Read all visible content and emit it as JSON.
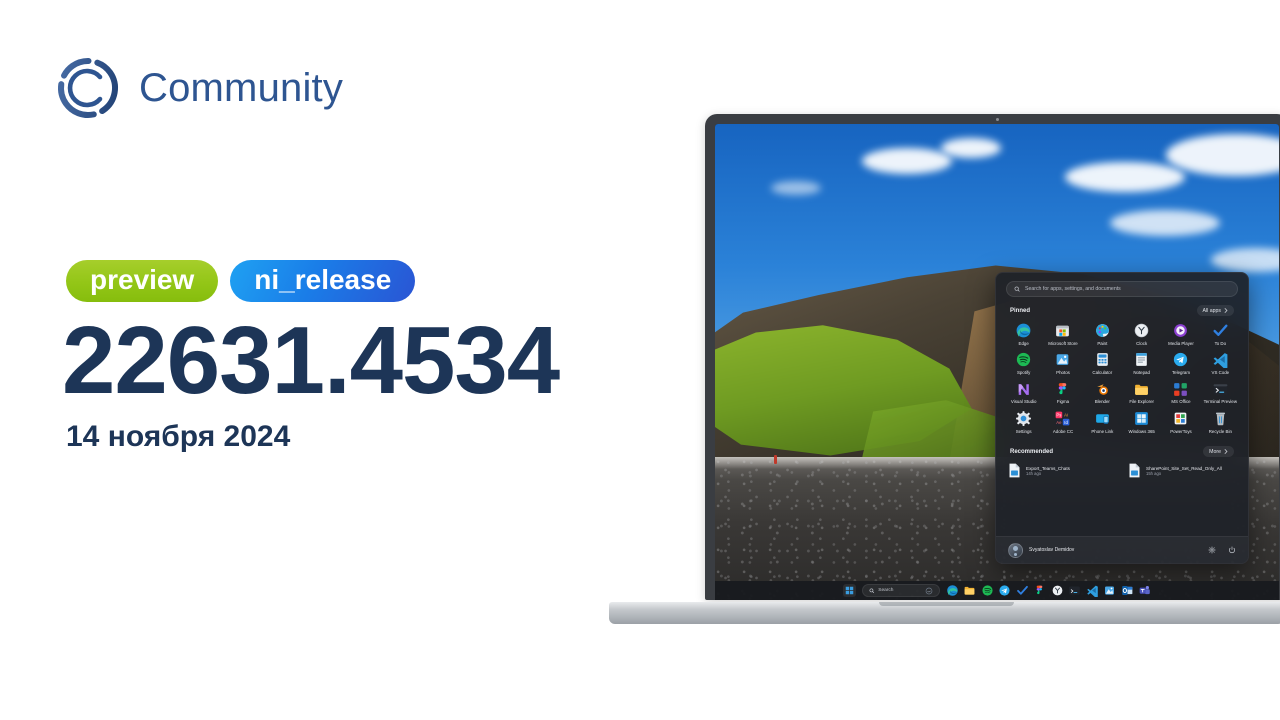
{
  "brand": {
    "name": "Community",
    "logo_icon": "community-ring-c-icon",
    "color": "#2e5591"
  },
  "release": {
    "badges": [
      {
        "label": "preview",
        "color": "#93c617"
      },
      {
        "label": "ni_release",
        "color": "#1a7de8"
      }
    ],
    "build": "22631.4534",
    "date": "14 ноября 2024",
    "text_color": "#1d3557"
  },
  "device": {
    "type": "laptop",
    "camera_icon": "webcam-dot-icon"
  },
  "wallpaper": {
    "description": "Iceland black sand beach with mossy basalt cliff under blue sky"
  },
  "start_menu": {
    "search": {
      "placeholder": "Search for apps, settings, and documents",
      "icon": "search-icon"
    },
    "pinned": {
      "title": "Pinned",
      "all_apps_label": "All apps",
      "all_apps_icon": "chevron-right-icon",
      "apps": [
        {
          "label": "Edge",
          "icon": "edge-icon"
        },
        {
          "label": "Microsoft Store",
          "icon": "microsoft-store-icon"
        },
        {
          "label": "Paint",
          "icon": "paint-icon"
        },
        {
          "label": "Clock",
          "icon": "clock-icon"
        },
        {
          "label": "Media Player",
          "icon": "media-player-icon"
        },
        {
          "label": "To Do",
          "icon": "to-do-icon"
        },
        {
          "label": "Spotify",
          "icon": "spotify-icon"
        },
        {
          "label": "Photos",
          "icon": "photos-icon"
        },
        {
          "label": "Calculator",
          "icon": "calculator-icon"
        },
        {
          "label": "Notepad",
          "icon": "notepad-icon"
        },
        {
          "label": "Telegram",
          "icon": "telegram-icon"
        },
        {
          "label": "VS Code",
          "icon": "vs-code-icon"
        },
        {
          "label": "Visual Studio",
          "icon": "visual-studio-icon"
        },
        {
          "label": "Figma",
          "icon": "figma-icon"
        },
        {
          "label": "Blender",
          "icon": "blender-icon"
        },
        {
          "label": "File Explorer",
          "icon": "file-explorer-icon"
        },
        {
          "label": "MS Office",
          "icon": "ms-office-icon"
        },
        {
          "label": "Terminal Preview",
          "icon": "terminal-preview-icon"
        },
        {
          "label": "Settings",
          "icon": "settings-gear-icon"
        },
        {
          "label": "Adobe CC",
          "icon": "adobe-cc-icon"
        },
        {
          "label": "Phone Link",
          "icon": "phone-link-icon"
        },
        {
          "label": "Windows 365",
          "icon": "windows-365-icon"
        },
        {
          "label": "PowerToys",
          "icon": "powertoys-icon"
        },
        {
          "label": "Recycle Bin",
          "icon": "recycle-bin-icon"
        }
      ]
    },
    "recommended": {
      "title": "Recommended",
      "more_label": "More",
      "more_icon": "chevron-right-icon",
      "items": [
        {
          "name": "Export_Teams_Chats",
          "time": "14h ago",
          "icon": "document-icon"
        },
        {
          "name": "SharePoint_Site_Set_Read_Only_All",
          "time": "15h ago",
          "icon": "document-icon"
        }
      ]
    },
    "footer": {
      "user": "Svyatoslav Demidov",
      "avatar_icon": "user-avatar-icon",
      "settings_icon": "settings-gear-icon",
      "power_icon": "power-icon"
    }
  },
  "taskbar": {
    "start_icon": "windows-start-icon",
    "search": {
      "label": "Search",
      "icon": "search-icon",
      "copilot_icon": "copilot-icon"
    },
    "apps": [
      {
        "name": "Edge",
        "icon": "edge-icon"
      },
      {
        "name": "File Explorer",
        "icon": "file-explorer-icon"
      },
      {
        "name": "Spotify",
        "icon": "spotify-icon"
      },
      {
        "name": "Telegram",
        "icon": "telegram-icon"
      },
      {
        "name": "To Do",
        "icon": "to-do-icon"
      },
      {
        "name": "Figma",
        "icon": "figma-icon"
      },
      {
        "name": "Clock",
        "icon": "clock-icon"
      },
      {
        "name": "Terminal",
        "icon": "terminal-icon"
      },
      {
        "name": "VS Code",
        "icon": "vs-code-icon"
      },
      {
        "name": "Photos",
        "icon": "photos-icon"
      },
      {
        "name": "Outlook",
        "icon": "outlook-icon"
      },
      {
        "name": "Teams",
        "icon": "teams-icon"
      }
    ]
  }
}
